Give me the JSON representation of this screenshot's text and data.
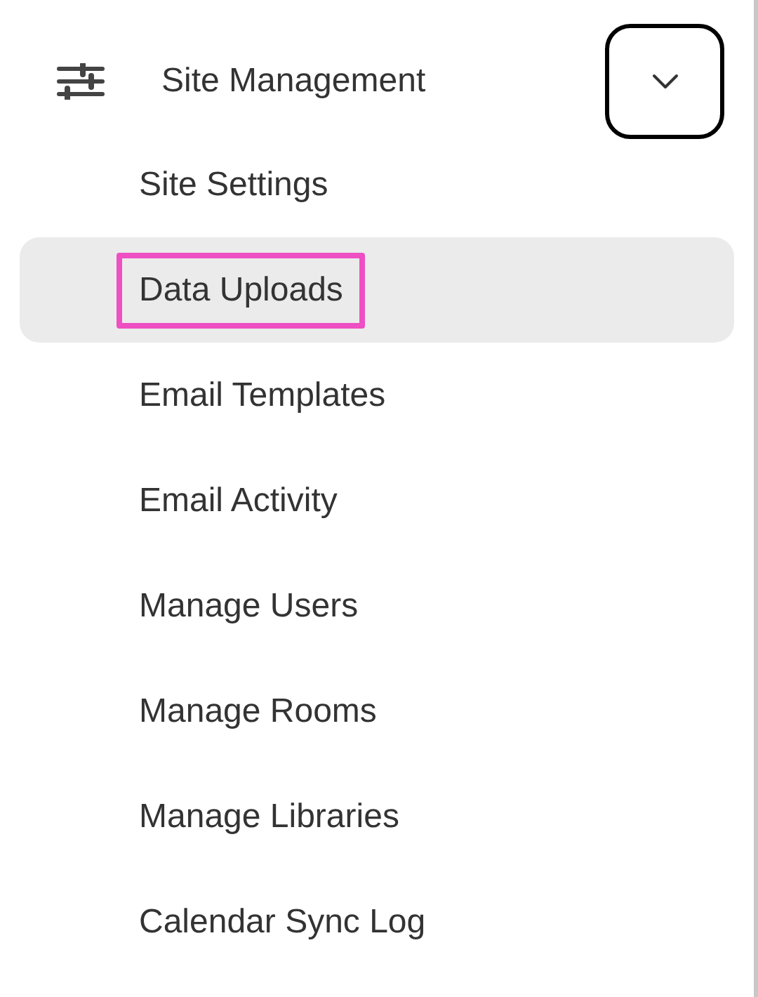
{
  "section": {
    "title": "Site Management",
    "expanded": true
  },
  "items": [
    {
      "label": "Site Settings",
      "selected": false,
      "focused": false
    },
    {
      "label": "Data Uploads",
      "selected": true,
      "focused": true
    },
    {
      "label": "Email Templates",
      "selected": false,
      "focused": false
    },
    {
      "label": "Email Activity",
      "selected": false,
      "focused": false
    },
    {
      "label": "Manage Users",
      "selected": false,
      "focused": false
    },
    {
      "label": "Manage Rooms",
      "selected": false,
      "focused": false
    },
    {
      "label": "Manage Libraries",
      "selected": false,
      "focused": false
    },
    {
      "label": "Calendar Sync Log",
      "selected": false,
      "focused": false
    }
  ]
}
